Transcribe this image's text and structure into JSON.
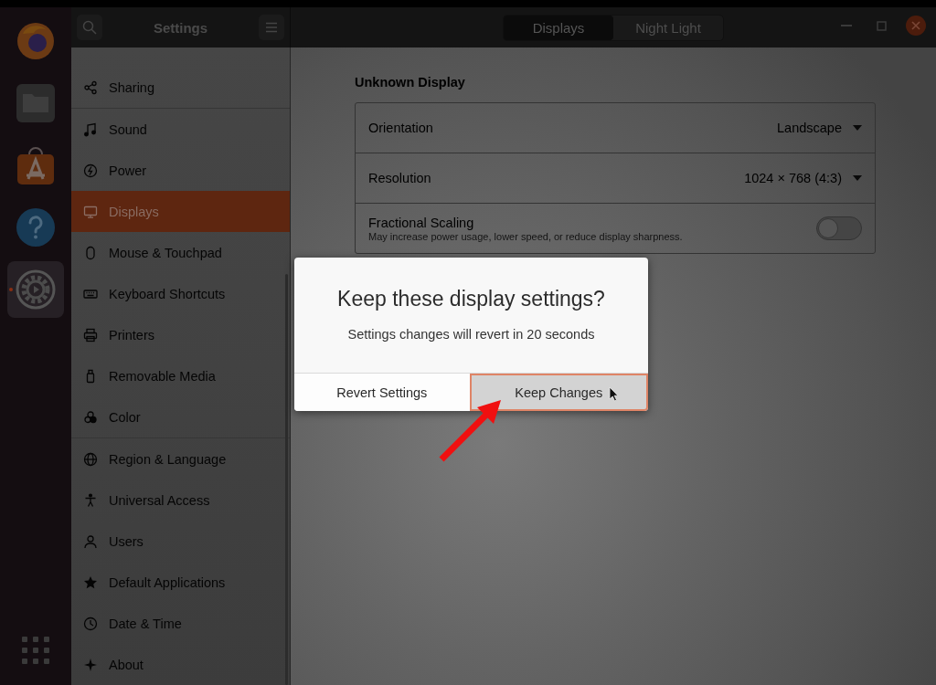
{
  "dock": {
    "items": [
      {
        "kind": "browser",
        "active": false
      },
      {
        "kind": "files",
        "active": false
      },
      {
        "kind": "software",
        "active": false
      },
      {
        "kind": "help",
        "active": false
      },
      {
        "kind": "settings",
        "active": true
      }
    ]
  },
  "header": {
    "title": "Settings",
    "tabs": [
      {
        "label": "Displays",
        "selected": true
      },
      {
        "label": "Night Light",
        "selected": false
      }
    ]
  },
  "sidebar": {
    "groups": [
      {
        "items": [
          {
            "label": "Sharing",
            "kind": "sharing",
            "selected": false
          }
        ]
      },
      {
        "items": [
          {
            "label": "Sound",
            "kind": "sound",
            "selected": false
          },
          {
            "label": "Power",
            "kind": "power",
            "selected": false
          },
          {
            "label": "Displays",
            "kind": "displays",
            "selected": true
          },
          {
            "label": "Mouse & Touchpad",
            "kind": "mouse",
            "selected": false
          },
          {
            "label": "Keyboard Shortcuts",
            "kind": "keyboard",
            "selected": false
          },
          {
            "label": "Printers",
            "kind": "printers",
            "selected": false
          },
          {
            "label": "Removable Media",
            "kind": "removable",
            "selected": false
          },
          {
            "label": "Color",
            "kind": "color",
            "selected": false
          }
        ]
      },
      {
        "items": [
          {
            "label": "Region & Language",
            "kind": "region",
            "selected": false
          },
          {
            "label": "Universal Access",
            "kind": "access",
            "selected": false
          },
          {
            "label": "Users",
            "kind": "users",
            "selected": false
          },
          {
            "label": "Default Applications",
            "kind": "apps",
            "selected": false
          },
          {
            "label": "Date & Time",
            "kind": "datetime",
            "selected": false
          },
          {
            "label": "About",
            "kind": "about",
            "selected": false
          }
        ]
      }
    ]
  },
  "display": {
    "heading": "Unknown Display",
    "rows": [
      {
        "kind": "dropdown",
        "label": "Orientation",
        "value": "Landscape"
      },
      {
        "kind": "dropdown",
        "label": "Resolution",
        "value": "1024 × 768 (4:3)"
      },
      {
        "kind": "toggle",
        "label": "Fractional Scaling",
        "description": "May increase power usage, lower speed, or reduce display sharpness.",
        "on": false
      }
    ]
  },
  "dialog": {
    "title": "Keep these display settings?",
    "message": "Settings changes will revert in 20 seconds",
    "buttons": [
      {
        "label": "Revert Settings",
        "highlighted": false
      },
      {
        "label": "Keep Changes",
        "highlighted": true
      }
    ]
  }
}
